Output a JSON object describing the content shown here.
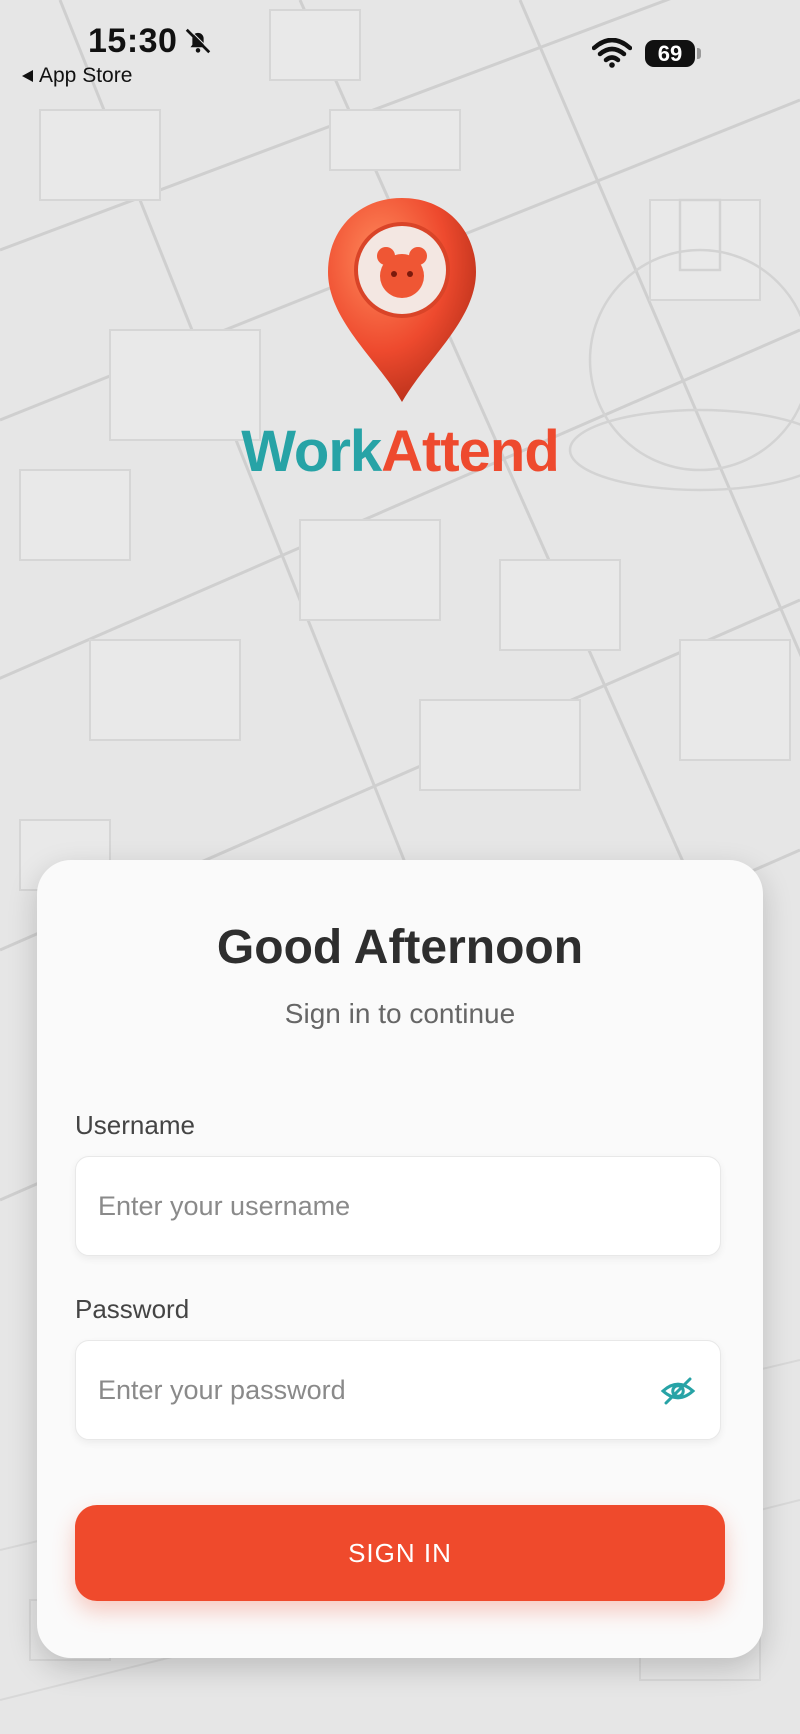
{
  "status_bar": {
    "time": "15:30",
    "back_label": "App Store",
    "battery": "69",
    "icons": [
      "bell-off-icon",
      "wifi-icon",
      "battery-icon"
    ]
  },
  "brand": {
    "name_part1": "Work",
    "name_part2": "Attend",
    "color_primary": "#27a3a6",
    "color_accent": "#ee4a2e"
  },
  "login": {
    "greeting": "Good Afternoon",
    "subtitle": "Sign in to continue",
    "username_label": "Username",
    "username_placeholder": "Enter your username",
    "username_value": "",
    "password_label": "Password",
    "password_placeholder": "Enter your password",
    "password_value": "",
    "signin_label": "SIGN IN",
    "signin_color": "#ef4a2c",
    "eye_icon": "eye-off-icon"
  }
}
